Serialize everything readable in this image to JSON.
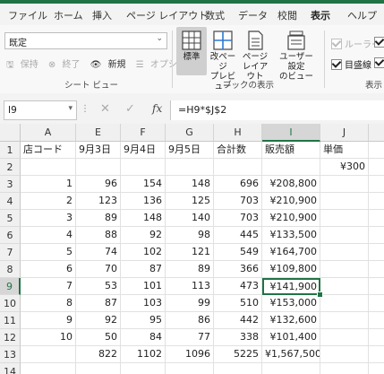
{
  "tabs": [
    "ファイル",
    "ホーム",
    "挿入",
    "ページ レイアウト",
    "数式",
    "データ",
    "校閲",
    "表示",
    "ヘルプ"
  ],
  "active_tab": "表示",
  "ribbon": {
    "sheet_view_select": "既定",
    "sheet_view_cmds": [
      "保持",
      "終了",
      "新規",
      "オプション"
    ],
    "sheet_view_group": "シート ビュー",
    "views": [
      {
        "line1": "標準",
        "line2": ""
      },
      {
        "line1": "改ページ",
        "line2": "プレビュー"
      },
      {
        "line1": "ページ",
        "line2": "レイアウト"
      },
      {
        "line1": "ユーザー設定",
        "line2": "のビュー"
      }
    ],
    "views_group": "ブックの表示",
    "show": {
      "ruler": "ルーラー",
      "gridlines": "目盛線"
    },
    "show_group": "表示"
  },
  "formula_bar": {
    "name_box": "I9",
    "formula": "=H9*$J$2"
  },
  "columns": [
    "A",
    "E",
    "F",
    "G",
    "H",
    "I",
    "J"
  ],
  "rows": [
    [
      "店コード",
      "9月3日",
      "9月4日",
      "9月5日",
      "合計数",
      "販売額",
      "単価"
    ],
    [
      "",
      "",
      "",
      "",
      "",
      "",
      "¥300"
    ],
    [
      "1",
      "96",
      "154",
      "148",
      "696",
      "¥208,800",
      ""
    ],
    [
      "2",
      "123",
      "136",
      "125",
      "703",
      "¥210,900",
      ""
    ],
    [
      "3",
      "89",
      "148",
      "140",
      "703",
      "¥210,900",
      ""
    ],
    [
      "4",
      "88",
      "92",
      "98",
      "445",
      "¥133,500",
      ""
    ],
    [
      "5",
      "74",
      "102",
      "121",
      "549",
      "¥164,700",
      ""
    ],
    [
      "6",
      "70",
      "87",
      "89",
      "366",
      "¥109,800",
      ""
    ],
    [
      "7",
      "53",
      "101",
      "113",
      "473",
      "¥141,900",
      ""
    ],
    [
      "8",
      "87",
      "103",
      "99",
      "510",
      "¥153,000",
      ""
    ],
    [
      "9",
      "92",
      "95",
      "86",
      "442",
      "¥132,600",
      ""
    ],
    [
      "10",
      "50",
      "84",
      "77",
      "338",
      "¥101,400",
      ""
    ],
    [
      "",
      "822",
      "1102",
      "1096",
      "5225",
      "¥1,567,500",
      ""
    ],
    [
      "",
      "",
      "",
      "",
      "",
      "",
      ""
    ]
  ],
  "active_cell": {
    "row": 9,
    "col": "I"
  }
}
